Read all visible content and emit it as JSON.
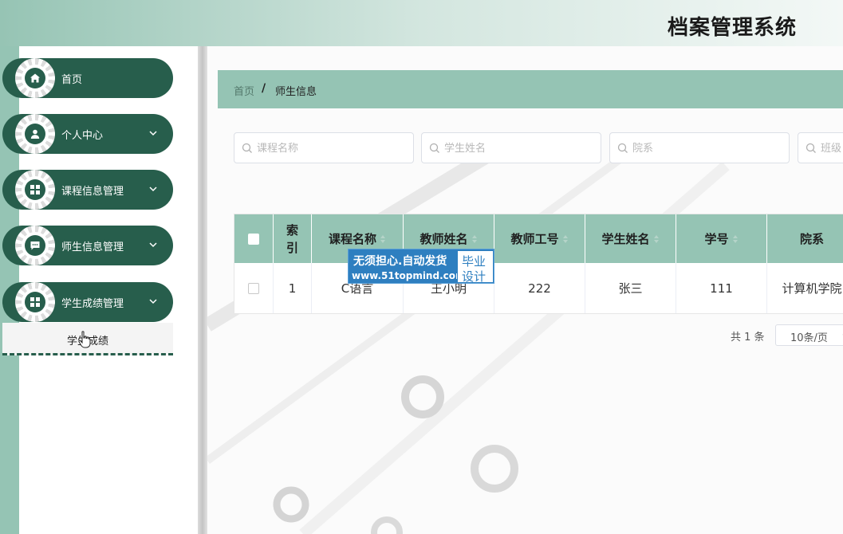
{
  "app": {
    "title": "档案管理系统"
  },
  "sidebar": {
    "items": [
      {
        "label": "首页",
        "icon": "home-icon",
        "has_children": false
      },
      {
        "label": "个人中心",
        "icon": "user-icon",
        "has_children": true
      },
      {
        "label": "课程信息管理",
        "icon": "grid-icon",
        "has_children": true
      },
      {
        "label": "师生信息管理",
        "icon": "chat-icon",
        "has_children": true
      },
      {
        "label": "学生成绩管理",
        "icon": "grid-icon",
        "has_children": true
      }
    ],
    "submenu": {
      "label": "学生成绩"
    }
  },
  "breadcrumb": {
    "home": "首页",
    "separator": "/",
    "current": "师生信息"
  },
  "search": {
    "fields": [
      {
        "placeholder": "课程名称"
      },
      {
        "placeholder": "学生姓名"
      },
      {
        "placeholder": "院系"
      },
      {
        "placeholder": "班级"
      }
    ]
  },
  "table": {
    "headers": [
      "索引",
      "课程名称",
      "教师姓名",
      "教师工号",
      "学生姓名",
      "学号",
      "院系"
    ],
    "rows": [
      {
        "index": "1",
        "course": "C语言",
        "teacher": "王小明",
        "teacher_id": "222",
        "student": "张三",
        "student_id": "111",
        "dept": "计算机学院"
      }
    ]
  },
  "pagination": {
    "total": "共 1 条",
    "page_size": "10条/页"
  },
  "watermark": {
    "line1": "无须担心.自动发货",
    "line2": "www.51topmind.com",
    "badge_line1": "毕业",
    "badge_line2": "设计"
  },
  "colors": {
    "sidebar_item_bg": "#275e4c",
    "accent_light": "#95c4b4",
    "watermark_blue": "#2e7fc0"
  }
}
